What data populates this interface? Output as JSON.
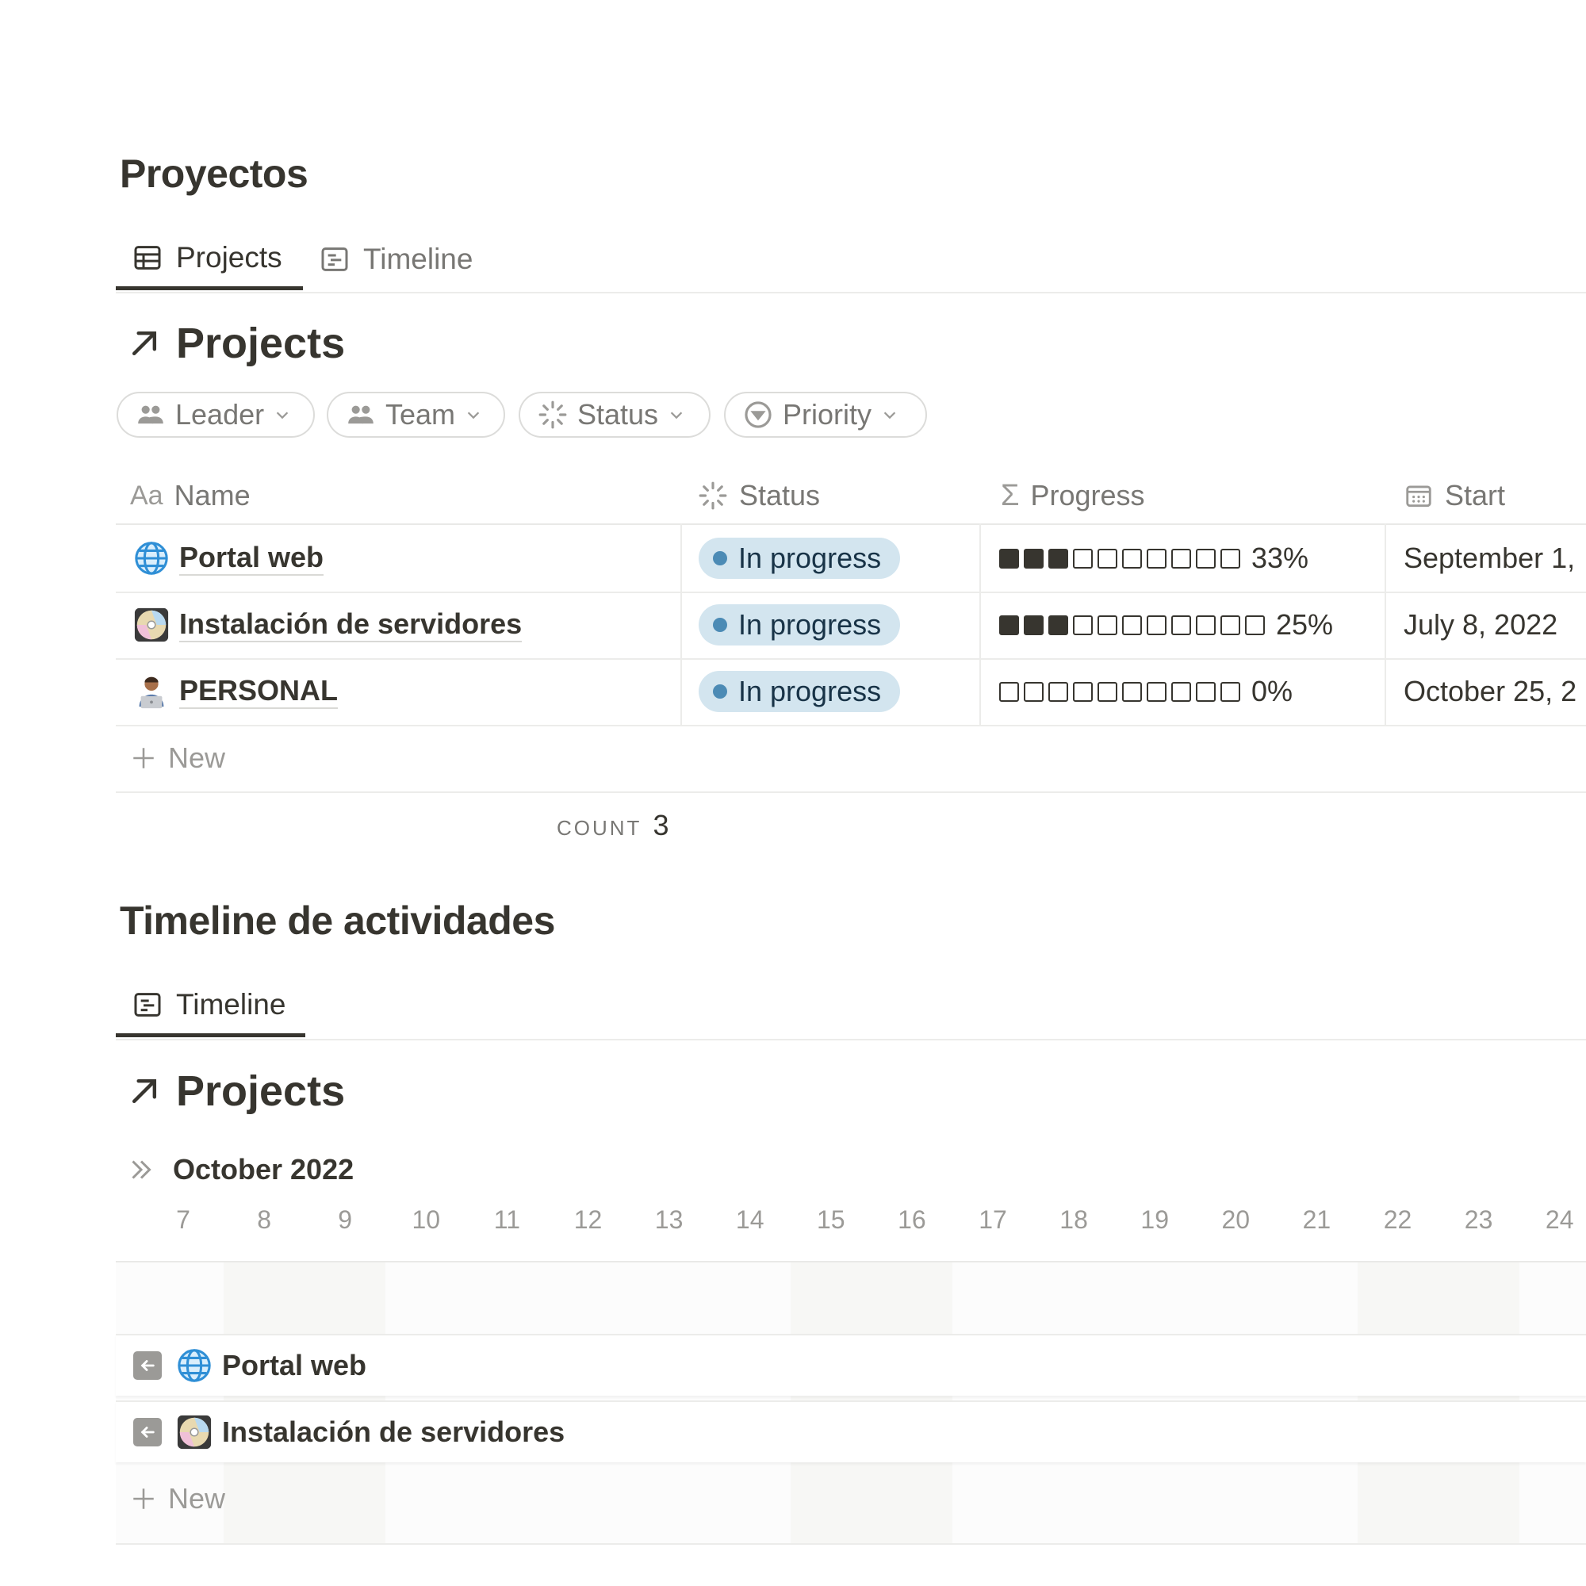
{
  "page": {
    "title": "Proyectos"
  },
  "projects_section": {
    "tabs": [
      {
        "label": "Projects",
        "icon": "table-icon",
        "active": true
      },
      {
        "label": "Timeline",
        "icon": "timeline-icon",
        "active": false
      }
    ],
    "view_title": "Projects",
    "filters": [
      {
        "label": "Leader",
        "icon": "people-icon"
      },
      {
        "label": "Team",
        "icon": "people-icon"
      },
      {
        "label": "Status",
        "icon": "status-icon"
      },
      {
        "label": "Priority",
        "icon": "priority-icon"
      }
    ],
    "columns": [
      {
        "label": "Name",
        "icon_text": "Aa"
      },
      {
        "label": "Status",
        "icon": "status-icon"
      },
      {
        "label": "Progress",
        "icon": "sigma-icon"
      },
      {
        "label": "Start",
        "icon": "calendar-icon"
      }
    ],
    "rows": [
      {
        "emoji": "globe-emoji",
        "name": "Portal web",
        "status": "In progress",
        "progress_filled": 3,
        "progress_total": 10,
        "progress_label": "33%",
        "start": "September 1,"
      },
      {
        "emoji": "disc-emoji",
        "name": "Instalación de servidores",
        "status": "In progress",
        "progress_filled": 3,
        "progress_total": 11,
        "progress_label": "25%",
        "start": "July 8, 2022"
      },
      {
        "emoji": "technologist-emoji",
        "name": "PERSONAL",
        "status": "In progress",
        "progress_filled": 0,
        "progress_total": 10,
        "progress_label": "0%",
        "start": "October 25, 2"
      }
    ],
    "new_label": "New",
    "count_label": "COUNT",
    "count_value": "3"
  },
  "timeline_section": {
    "title": "Timeline de actividades",
    "tab": {
      "label": "Timeline",
      "icon": "timeline-icon"
    },
    "view_title": "Projects",
    "month": "October 2022",
    "days": [
      "7",
      "8",
      "9",
      "10",
      "11",
      "12",
      "13",
      "14",
      "15",
      "16",
      "17",
      "18",
      "19",
      "20",
      "21",
      "22",
      "23",
      "24"
    ],
    "rows": [
      {
        "emoji": "globe-emoji",
        "name": "Portal web"
      },
      {
        "emoji": "disc-emoji",
        "name": "Instalación de servidores"
      }
    ],
    "new_label": "New"
  },
  "colors": {
    "text": "#37352f",
    "muted": "#787774",
    "status_pill_bg": "#d3e5ef",
    "status_dot": "#4c8bb5"
  }
}
